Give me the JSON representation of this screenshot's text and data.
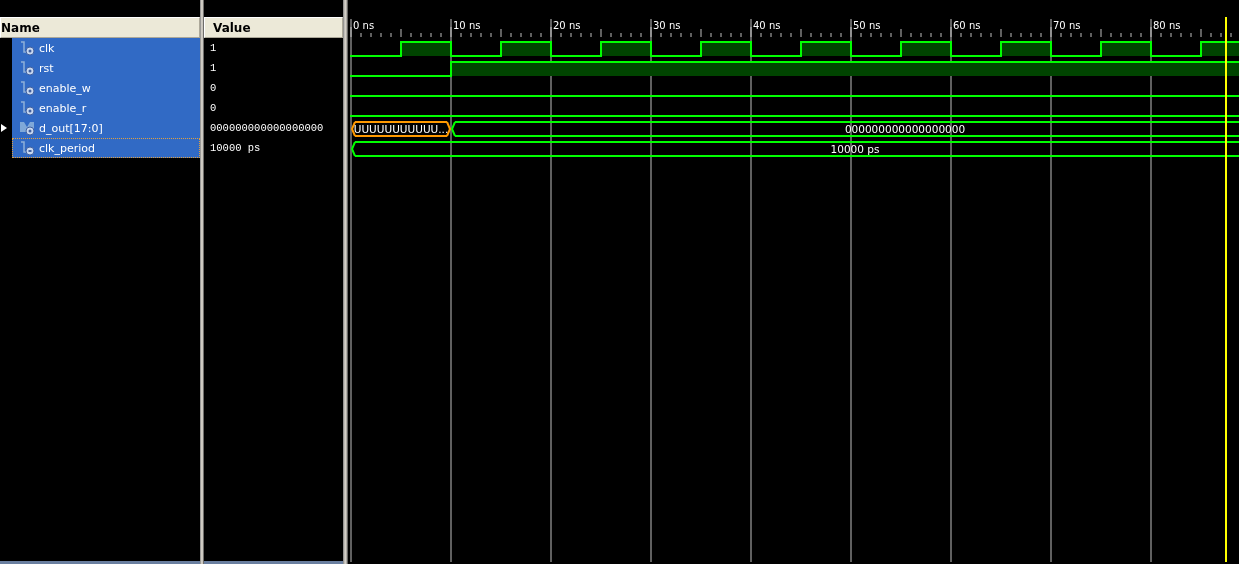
{
  "name_header": "Name",
  "value_header": "Value",
  "time_labels": [
    "0 ns",
    "10 ns",
    "20 ns",
    "30 ns",
    "40 ns",
    "50 ns",
    "60 ns",
    "70 ns",
    "80 ns"
  ],
  "signals": [
    {
      "name": "clk",
      "kind": "bit",
      "value": "1",
      "selected": true,
      "focused": false,
      "steps": [
        false,
        true,
        false,
        true,
        false,
        true,
        false,
        true,
        false,
        true,
        false,
        true,
        false,
        true,
        false,
        true,
        false,
        true
      ]
    },
    {
      "name": "rst",
      "kind": "bit",
      "value": "1",
      "selected": true,
      "focused": false,
      "steps": [
        false,
        false,
        true,
        true,
        true,
        true,
        true,
        true,
        true,
        true,
        true,
        true,
        true,
        true,
        true,
        true,
        true,
        true
      ]
    },
    {
      "name": "enable_w",
      "kind": "bit",
      "value": "0",
      "selected": true,
      "focused": false,
      "steps": [
        false,
        false,
        false,
        false,
        false,
        false,
        false,
        false,
        false,
        false,
        false,
        false,
        false,
        false,
        false,
        false,
        false,
        false
      ]
    },
    {
      "name": "enable_r",
      "kind": "bit",
      "value": "0",
      "selected": true,
      "focused": false,
      "steps": [
        false,
        false,
        false,
        false,
        false,
        false,
        false,
        false,
        false,
        false,
        false,
        false,
        false,
        false,
        false,
        false,
        false,
        false
      ]
    },
    {
      "name": "d_out[17:0]",
      "kind": "bus",
      "value": "000000000000000000",
      "selected": true,
      "focused": false,
      "steps": [
        true,
        false,
        true,
        false,
        false,
        false,
        false,
        false,
        false,
        false,
        false,
        false,
        false,
        false,
        false,
        false,
        false,
        false
      ],
      "segments": [
        {
          "kind": "undefined",
          "label": "UUUUUUUUUUU..."
        },
        {
          "kind": "value",
          "label": "000000000000000000"
        }
      ]
    },
    {
      "name": "clk_period",
      "kind": "const",
      "value": "10000 ps",
      "selected": true,
      "focused": true,
      "steps": [
        true,
        false,
        false,
        false,
        false,
        false,
        false,
        false,
        false,
        false,
        false,
        false,
        false,
        false,
        false,
        false,
        false,
        false
      ],
      "segments": [
        {
          "kind": "value",
          "label": "10000 ps"
        }
      ]
    }
  ]
}
